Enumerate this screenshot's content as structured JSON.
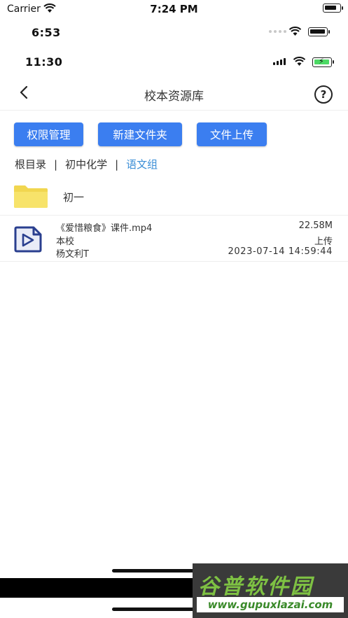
{
  "status_bar_top": {
    "carrier": "Carrier",
    "time": "7:24 PM"
  },
  "status_bar_2": {
    "time": "6:53"
  },
  "status_bar_3": {
    "time": "11:30"
  },
  "nav": {
    "title": "校本资源库",
    "help_glyph": "?"
  },
  "actions": {
    "permissions_label": "权限管理",
    "new_folder_label": "新建文件夹",
    "upload_label": "文件上传"
  },
  "breadcrumb": {
    "items": [
      {
        "label": "根目录"
      },
      {
        "label": "初中化学"
      },
      {
        "label": "语文组"
      }
    ],
    "separator": "|"
  },
  "folders": [
    {
      "name": "初一",
      "icon": "folder-icon",
      "color": "#f7e36a"
    }
  ],
  "files": [
    {
      "name": "《爱惜粮食》课件.mp4",
      "size": "22.58M",
      "scope": "本校",
      "action": "上传",
      "uploader": "杨文利T",
      "datetime": "2023-07-14 14:59:44",
      "icon": "video-file-icon"
    }
  ],
  "watermark": {
    "title": "谷普软件园",
    "url": "www.gupuxlazai.com"
  },
  "colors": {
    "accent": "#3b7ef0",
    "link": "#3b8ed6",
    "folder": "#f7e36a",
    "file_icon": "#2a3f8f"
  }
}
